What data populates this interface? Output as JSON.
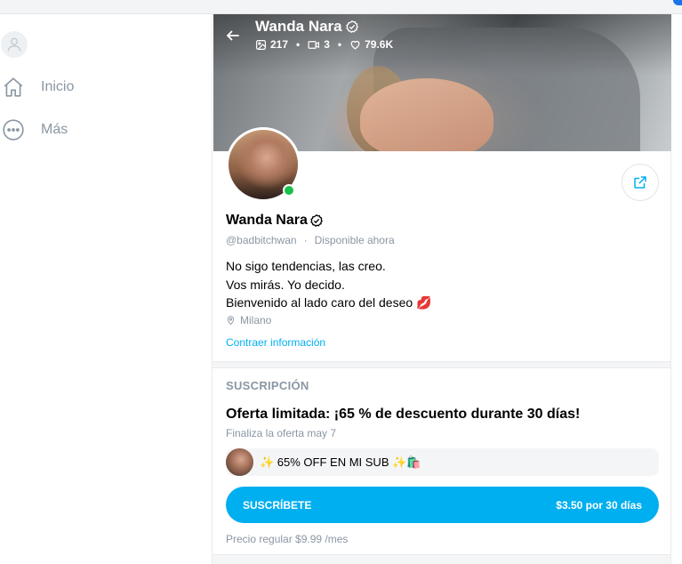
{
  "colors": {
    "accent": "#00aff0",
    "muted": "#8a96a3",
    "online": "#19c14a"
  },
  "sidebar": {
    "avatar_icon": "user-avatar-icon",
    "items": [
      {
        "label": "Inicio",
        "icon": "home-icon"
      },
      {
        "label": "Más",
        "icon": "more-dots-icon"
      }
    ]
  },
  "header": {
    "name": "Wanda Nara",
    "verified_icon": "verified-badge-icon",
    "stats": {
      "photos": "217",
      "videos": "3",
      "likes": "79.6K"
    }
  },
  "profile": {
    "name": "Wanda Nara",
    "handle": "@badbitchwan",
    "status": "Disponible ahora",
    "bio": [
      "No sigo tendencias, las creo.",
      "Vos mirás. Yo decido.",
      "Bienvenido al lado caro del deseo 💋"
    ],
    "location": "Milano",
    "collapse_label": "Contraer información"
  },
  "subscription": {
    "section_title": "SUSCRIPCIÓN",
    "offer_title": "Oferta limitada: ¡65 % de descuento durante 30 días!",
    "offer_ends": "Finaliza la oferta may 7",
    "promo_text": "✨ 65% OFF EN MI SUB ✨🛍️",
    "button_label": "SUSCRÍBETE",
    "button_price": "$3.50 por 30 días",
    "regular_price": "Precio regular $9.99 /mes"
  }
}
